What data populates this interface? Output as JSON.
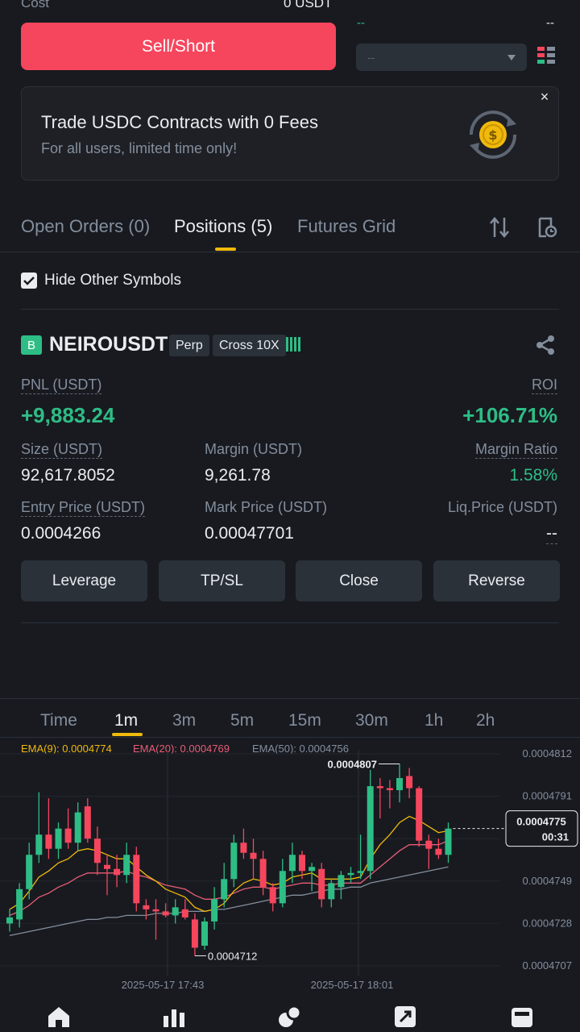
{
  "order": {
    "cost_label": "Cost",
    "cost_value": "0 USDT",
    "dash_left": "--",
    "dash_right": "--",
    "sell_label": "Sell/Short",
    "select_value": "--"
  },
  "promo": {
    "title": "Trade USDC Contracts with 0 Fees",
    "subtitle": "For all users, limited time only!",
    "close_glyph": "×"
  },
  "tabs": [
    {
      "label": "Open Orders (0)",
      "active": false
    },
    {
      "label": "Positions (5)",
      "active": true
    },
    {
      "label": "Futures Grid",
      "active": false
    }
  ],
  "filter": {
    "hide_label": "Hide Other Symbols",
    "checked": true
  },
  "position": {
    "badge": "B",
    "symbol": "NEIROUSDT",
    "type_chip": "Perp",
    "margin_chip": "Cross 10X",
    "pnl_label": "PNL (USDT)",
    "pnl_value": "+9,883.24",
    "roi_label": "ROI",
    "roi_value": "+106.71%",
    "size_label": "Size (USDT)",
    "size_value": "92,617.8052",
    "margin_label": "Margin (USDT)",
    "margin_value": "9,261.78",
    "mratio_label": "Margin Ratio",
    "mratio_value": "1.58%",
    "entry_label": "Entry Price (USDT)",
    "entry_value": "0.0004266",
    "mark_label": "Mark Price (USDT)",
    "mark_value": "0.00047701",
    "liq_label": "Liq.Price (USDT)",
    "liq_value": "--",
    "actions": [
      "Leverage",
      "TP/SL",
      "Close",
      "Reverse"
    ]
  },
  "timeframes": [
    "Time",
    "1m",
    "3m",
    "5m",
    "15m",
    "30m",
    "1h",
    "2h"
  ],
  "active_timeframe": "1m",
  "colors": {
    "up": "#2ebd85",
    "down": "#f6465d",
    "accent": "#f0b90b",
    "ema9": "#f0b90b",
    "ema20": "#e85d75",
    "ema50": "#848e9c"
  },
  "chart_data": {
    "type": "candlestick",
    "ema_labels": [
      "EMA(9): 0.0004774",
      "EMA(20): 0.0004769",
      "EMA(50): 0.0004756"
    ],
    "y_ticks": [
      "0.0004812",
      "0.0004791",
      "0.0004770",
      "0.0004749",
      "0.0004728",
      "0.0004707"
    ],
    "ylim": [
      0.0004707,
      0.0004812
    ],
    "x_ticks": [
      "2025-05-17 17:43",
      "2025-05-17 18:01"
    ],
    "high_label": "0.0004807",
    "low_label": "0.0004712",
    "current_price": "0.0004775",
    "countdown": "00:31",
    "candles": [
      {
        "o": 0.0004728,
        "h": 0.0004735,
        "l": 0.0004724,
        "c": 0.0004731
      },
      {
        "o": 0.000473,
        "h": 0.0004748,
        "l": 0.0004726,
        "c": 0.0004745
      },
      {
        "o": 0.0004745,
        "h": 0.0004768,
        "l": 0.000474,
        "c": 0.0004762
      },
      {
        "o": 0.0004762,
        "h": 0.0004793,
        "l": 0.0004758,
        "c": 0.0004772
      },
      {
        "o": 0.0004772,
        "h": 0.000479,
        "l": 0.000476,
        "c": 0.0004765
      },
      {
        "o": 0.0004765,
        "h": 0.0004778,
        "l": 0.000476,
        "c": 0.0004775
      },
      {
        "o": 0.0004775,
        "h": 0.0004785,
        "l": 0.0004765,
        "c": 0.0004768
      },
      {
        "o": 0.0004768,
        "h": 0.0004788,
        "l": 0.0004764,
        "c": 0.0004783
      },
      {
        "o": 0.0004786,
        "h": 0.000479,
        "l": 0.0004768,
        "c": 0.000477
      },
      {
        "o": 0.000477,
        "h": 0.0004776,
        "l": 0.0004752,
        "c": 0.0004758
      },
      {
        "o": 0.0004757,
        "h": 0.0004762,
        "l": 0.0004742,
        "c": 0.0004755
      },
      {
        "o": 0.0004755,
        "h": 0.0004762,
        "l": 0.0004746,
        "c": 0.0004752
      },
      {
        "o": 0.0004752,
        "h": 0.0004768,
        "l": 0.0004748,
        "c": 0.0004762
      },
      {
        "o": 0.0004762,
        "h": 0.0004766,
        "l": 0.0004734,
        "c": 0.0004738
      },
      {
        "o": 0.0004737,
        "h": 0.000474,
        "l": 0.000473,
        "c": 0.0004735
      },
      {
        "o": 0.0004735,
        "h": 0.000474,
        "l": 0.000472,
        "c": 0.0004734
      },
      {
        "o": 0.0004734,
        "h": 0.0004738,
        "l": 0.0004731,
        "c": 0.0004732
      },
      {
        "o": 0.0004732,
        "h": 0.000474,
        "l": 0.0004728,
        "c": 0.0004736
      },
      {
        "o": 0.0004735,
        "h": 0.000474,
        "l": 0.000473,
        "c": 0.0004731
      },
      {
        "o": 0.000473,
        "h": 0.0004733,
        "l": 0.0004712,
        "c": 0.0004716
      },
      {
        "o": 0.0004717,
        "h": 0.0004731,
        "l": 0.0004715,
        "c": 0.0004729
      },
      {
        "o": 0.0004729,
        "h": 0.0004746,
        "l": 0.0004725,
        "c": 0.000474
      },
      {
        "o": 0.000474,
        "h": 0.0004758,
        "l": 0.0004736,
        "c": 0.000475
      },
      {
        "o": 0.000475,
        "h": 0.0004772,
        "l": 0.0004746,
        "c": 0.0004768
      },
      {
        "o": 0.0004768,
        "h": 0.0004775,
        "l": 0.000476,
        "c": 0.0004763
      },
      {
        "o": 0.0004763,
        "h": 0.000477,
        "l": 0.000475,
        "c": 0.000476
      },
      {
        "o": 0.000476,
        "h": 0.0004764,
        "l": 0.0004742,
        "c": 0.0004746
      },
      {
        "o": 0.0004746,
        "h": 0.0004748,
        "l": 0.0004734,
        "c": 0.0004738
      },
      {
        "o": 0.0004738,
        "h": 0.000476,
        "l": 0.0004736,
        "c": 0.0004754
      },
      {
        "o": 0.0004754,
        "h": 0.0004768,
        "l": 0.0004748,
        "c": 0.0004762
      },
      {
        "o": 0.0004762,
        "h": 0.0004764,
        "l": 0.000475,
        "c": 0.0004754
      },
      {
        "o": 0.0004754,
        "h": 0.0004758,
        "l": 0.0004744,
        "c": 0.0004756
      },
      {
        "o": 0.0004755,
        "h": 0.0004758,
        "l": 0.0004736,
        "c": 0.000474
      },
      {
        "o": 0.000474,
        "h": 0.000475,
        "l": 0.0004736,
        "c": 0.0004748
      },
      {
        "o": 0.0004746,
        "h": 0.0004754,
        "l": 0.000474,
        "c": 0.0004752
      },
      {
        "o": 0.0004752,
        "h": 0.0004756,
        "l": 0.0004748,
        "c": 0.0004753
      },
      {
        "o": 0.0004753,
        "h": 0.0004772,
        "l": 0.000475,
        "c": 0.0004754
      },
      {
        "o": 0.0004754,
        "h": 0.0004804,
        "l": 0.000475,
        "c": 0.0004796
      },
      {
        "o": 0.0004796,
        "h": 0.00048,
        "l": 0.000478,
        "c": 0.0004795
      },
      {
        "o": 0.0004795,
        "h": 0.0004799,
        "l": 0.0004785,
        "c": 0.0004794
      },
      {
        "o": 0.0004794,
        "h": 0.0004807,
        "l": 0.0004788,
        "c": 0.00048
      },
      {
        "o": 0.0004801,
        "h": 0.0004805,
        "l": 0.000479,
        "c": 0.0004795
      },
      {
        "o": 0.0004795,
        "h": 0.0004796,
        "l": 0.0004766,
        "c": 0.0004769
      },
      {
        "o": 0.0004769,
        "h": 0.0004772,
        "l": 0.0004755,
        "c": 0.0004765
      },
      {
        "o": 0.0004765,
        "h": 0.000477,
        "l": 0.000476,
        "c": 0.0004762
      },
      {
        "o": 0.0004762,
        "h": 0.0004778,
        "l": 0.0004758,
        "c": 0.0004775
      }
    ],
    "ema9": [
      0.0004735,
      0.0004738,
      0.0004744,
      0.0004751,
      0.0004754,
      0.0004758,
      0.000476,
      0.0004764,
      0.0004765,
      0.0004764,
      0.0004762,
      0.000476,
      0.000476,
      0.0004756,
      0.0004752,
      0.0004749,
      0.0004745,
      0.0004743,
      0.0004741,
      0.0004736,
      0.0004734,
      0.0004735,
      0.0004738,
      0.0004744,
      0.0004748,
      0.000475,
      0.0004749,
      0.0004747,
      0.0004748,
      0.0004751,
      0.0004752,
      0.0004753,
      0.000475,
      0.000475,
      0.000475,
      0.000475,
      0.0004751,
      0.000476,
      0.0004767,
      0.0004772,
      0.0004778,
      0.0004781,
      0.0004779,
      0.0004776,
      0.0004773,
      0.0004774
    ],
    "ema20": [
      0.0004732,
      0.0004734,
      0.0004737,
      0.0004741,
      0.0004743,
      0.0004746,
      0.0004748,
      0.0004751,
      0.0004753,
      0.0004753,
      0.0004753,
      0.0004753,
      0.0004754,
      0.0004752,
      0.0004751,
      0.0004749,
      0.0004747,
      0.0004746,
      0.0004745,
      0.0004742,
      0.000474,
      0.000474,
      0.0004741,
      0.0004743,
      0.0004745,
      0.0004746,
      0.0004746,
      0.0004745,
      0.0004746,
      0.0004747,
      0.0004748,
      0.0004748,
      0.0004747,
      0.0004747,
      0.0004748,
      0.0004748,
      0.0004748,
      0.0004752,
      0.0004756,
      0.000476,
      0.0004764,
      0.0004767,
      0.0004767,
      0.0004767,
      0.0004767,
      0.0004769
    ],
    "ema50": [
      0.0004722,
      0.0004723,
      0.0004724,
      0.0004725,
      0.0004726,
      0.0004727,
      0.0004728,
      0.0004729,
      0.000473,
      0.000473,
      0.0004731,
      0.0004731,
      0.0004732,
      0.0004732,
      0.0004732,
      0.0004733,
      0.0004733,
      0.0004733,
      0.0004734,
      0.0004734,
      0.0004734,
      0.0004735,
      0.0004735,
      0.0004736,
      0.0004737,
      0.0004738,
      0.0004739,
      0.000474,
      0.0004741,
      0.0004742,
      0.0004742,
      0.0004743,
      0.0004744,
      0.0004745,
      0.0004745,
      0.0004746,
      0.0004746,
      0.0004748,
      0.0004749,
      0.000475,
      0.0004751,
      0.0004752,
      0.0004753,
      0.0004754,
      0.0004755,
      0.0004756
    ]
  },
  "nav": [
    {
      "name": "home-icon"
    },
    {
      "name": "markets-icon"
    },
    {
      "name": "trade-icon"
    },
    {
      "name": "futures-icon"
    },
    {
      "name": "wallet-icon"
    }
  ]
}
